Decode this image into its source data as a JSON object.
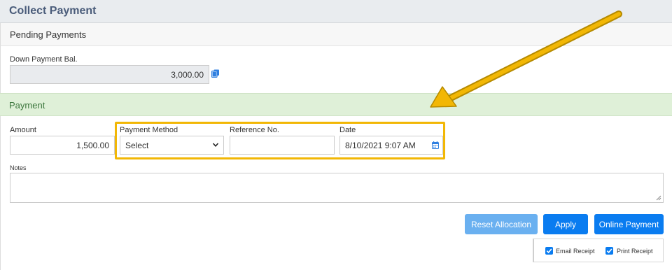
{
  "header": {
    "title": "Collect Payment"
  },
  "pending": {
    "section_title": "Pending Payments",
    "down_payment_label": "Down Payment Bal.",
    "down_payment_value": "3,000.00"
  },
  "payment": {
    "section_title": "Payment",
    "amount_label": "Amount",
    "amount_value": "1,500.00",
    "method_label": "Payment Method",
    "method_value": "Select",
    "reference_label": "Reference No.",
    "reference_value": "",
    "date_label": "Date",
    "date_value": "8/10/2021 9:07 AM",
    "notes_label": "Notes",
    "notes_value": ""
  },
  "actions": {
    "reset_label": "Reset Allocation",
    "apply_label": "Apply",
    "online_label": "Online Payment"
  },
  "receipt": {
    "email_label": "Email Receipt",
    "email_checked": true,
    "print_label": "Print Receipt",
    "print_checked": true
  },
  "colors": {
    "accent": "#0a7cf0",
    "highlight": "#f2b705",
    "payment_bg": "#dff0d8"
  },
  "icons": [
    "copy-icon",
    "chevron-down-icon",
    "calendar-icon",
    "checkbox-check-icon",
    "annotation-arrow"
  ]
}
